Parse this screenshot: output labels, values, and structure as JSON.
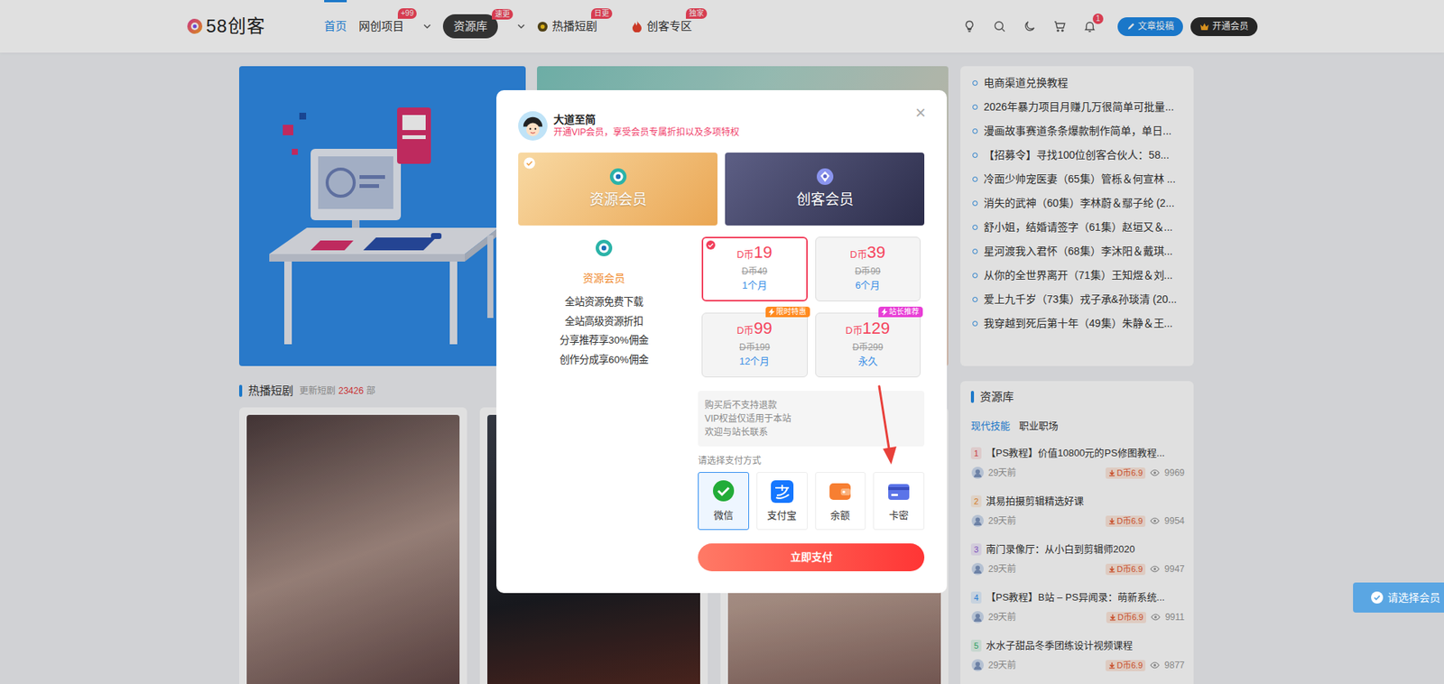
{
  "header": {
    "logo": "58创客",
    "nav": [
      {
        "label": "首页",
        "selected": true,
        "kind": "link",
        "dropdown": false
      },
      {
        "label": "网创项目",
        "selected": false,
        "kind": "link",
        "dropdown": true,
        "badge": "+99"
      },
      {
        "label": "资源库",
        "selected": false,
        "kind": "pill",
        "dropdown": true,
        "badge": "速更"
      },
      {
        "label": "热播短剧",
        "selected": false,
        "kind": "play",
        "dropdown": false,
        "badge": "日更"
      },
      {
        "label": "创客专区",
        "selected": false,
        "kind": "fire",
        "dropdown": false,
        "badge": "独家"
      }
    ],
    "notification_count": "1",
    "buttons": [
      {
        "label": "文章投稿",
        "kind": "post"
      },
      {
        "label": "开通会员",
        "kind": "vip"
      }
    ]
  },
  "sidebar": {
    "links": [
      "电商渠道兑换教程",
      "2026年暴力项目月赚几万很简单可批量...",
      "漫画故事赛道条条爆款制作简单，单日...",
      "【招募令】寻找100位创客合伙人：58...",
      "冷面少帅宠医妻（65集）管栎＆何宣林 ...",
      "消失的武神（60集）李林蔚＆鄢子纶 (2...",
      "舒小姐，结婚请签字（61集）赵垣又＆...",
      "星河渡我入君怀（68集）李沐阳＆戴琪...",
      "从你的全世界离开（71集）王知煜＆刘...",
      "爱上九千岁（73集）戎子承&孙琰清 (20...",
      "我穿越到死后第十年（49集）朱静＆王..."
    ]
  },
  "resources": {
    "title": "资源库",
    "tabs": [
      {
        "label": "现代技能",
        "selected": true
      },
      {
        "label": "职业职场",
        "selected": false
      }
    ],
    "items": [
      {
        "rank": "1",
        "title": "【PS教程】价值10800元的PS修图教程...",
        "time": "29天前",
        "price": "D币6.9",
        "views": "9969",
        "color": "#e5484d"
      },
      {
        "rank": "2",
        "title": "淇易拍摄剪辑精选好课",
        "time": "29天前",
        "price": "D币6.9",
        "views": "9954",
        "color": "#f08c2b"
      },
      {
        "rank": "3",
        "title": "南门录像厅：从小白到剪辑师2020",
        "time": "29天前",
        "price": "D币6.9",
        "views": "9947",
        "color": "#8e5bd6"
      },
      {
        "rank": "4",
        "title": "【PS教程】B站 – PS异闻录：萌新系统...",
        "time": "29天前",
        "price": "D币6.9",
        "views": "9911",
        "color": "#2d8cf0"
      },
      {
        "rank": "5",
        "title": "水水子甜品冬季团练设计视频课程",
        "time": "29天前",
        "price": "D币6.9",
        "views": "9877",
        "color": "#2fb36d"
      }
    ]
  },
  "drama": {
    "title": "热播短剧",
    "caption": "更新短剧",
    "count": "23426",
    "unit": "部"
  },
  "modal": {
    "user": "大道至简",
    "subtitle": "开通VIP会员，享受会员专属折扣以及多项特权",
    "close": "×",
    "plans": [
      {
        "label": "资源会员",
        "selected": true,
        "kind": "resource"
      },
      {
        "label": "创客会员",
        "selected": false,
        "kind": "creator"
      }
    ],
    "detail": {
      "title": "资源会员",
      "benefits": [
        "全站资源免费下载",
        "全站高级资源折扣",
        "分享推荐享30%佣金",
        "创作分成享60%佣金"
      ]
    },
    "prices": [
      {
        "currency": "D币",
        "amount": "19",
        "original": "D币49",
        "period": "1个月",
        "selected": true
      },
      {
        "currency": "D币",
        "amount": "39",
        "original": "D币99",
        "period": "6个月",
        "selected": false
      },
      {
        "currency": "D币",
        "amount": "99",
        "original": "D币199",
        "period": "12个月",
        "selected": false,
        "tag": "限时特惠"
      },
      {
        "currency": "D币",
        "amount": "129",
        "original": "D币299",
        "period": "永久",
        "selected": false,
        "tag": "站长推荐"
      }
    ],
    "notice": [
      "购买后不支持退款",
      "VIP权益仅适用于本站",
      "欢迎与站长联系"
    ],
    "pay_label": "请选择支付方式",
    "payments": [
      {
        "label": "微信",
        "selected": true,
        "kind": "wechat"
      },
      {
        "label": "支付宝",
        "selected": false,
        "kind": "alipay"
      },
      {
        "label": "余额",
        "selected": false,
        "kind": "balance"
      },
      {
        "label": "卡密",
        "selected": false,
        "kind": "card"
      }
    ],
    "submit": "立即支付"
  },
  "toast": "请选择会员"
}
